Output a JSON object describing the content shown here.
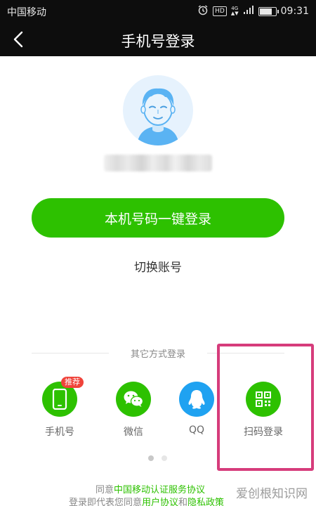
{
  "status_bar": {
    "carrier": "中国移动",
    "hd": "HD",
    "network": "4G",
    "time": "09:31"
  },
  "nav": {
    "title": "手机号登录"
  },
  "main": {
    "login_button": "本机号码一键登录",
    "switch_account": "切换账号"
  },
  "other_methods": {
    "title": "其它方式登录",
    "items": [
      {
        "label": "手机号",
        "icon": "phone-icon",
        "badge": "推荐",
        "color": "#2dc100"
      },
      {
        "label": "微信",
        "icon": "wechat-icon",
        "color": "#2dc100"
      },
      {
        "label": "QQ",
        "icon": "qq-icon",
        "color": "#1fa2f1"
      },
      {
        "label": "扫码登录",
        "icon": "qr-code-icon",
        "color": "#2dc100"
      }
    ]
  },
  "pager": {
    "count": 2,
    "active": 0
  },
  "agreement": {
    "line1_prefix": "同意",
    "line1_link": "中国移动认证服务协议",
    "line2_prefix": "登录即代表您同意",
    "line2_link1": "用户协议",
    "line2_and": "和",
    "line2_link2": "隐私政策"
  },
  "watermark": "爱创根知识网",
  "colors": {
    "accent": "#2dc100",
    "qq": "#1fa2f1",
    "badge": "#f0433a",
    "highlight": "#d63c7b"
  }
}
